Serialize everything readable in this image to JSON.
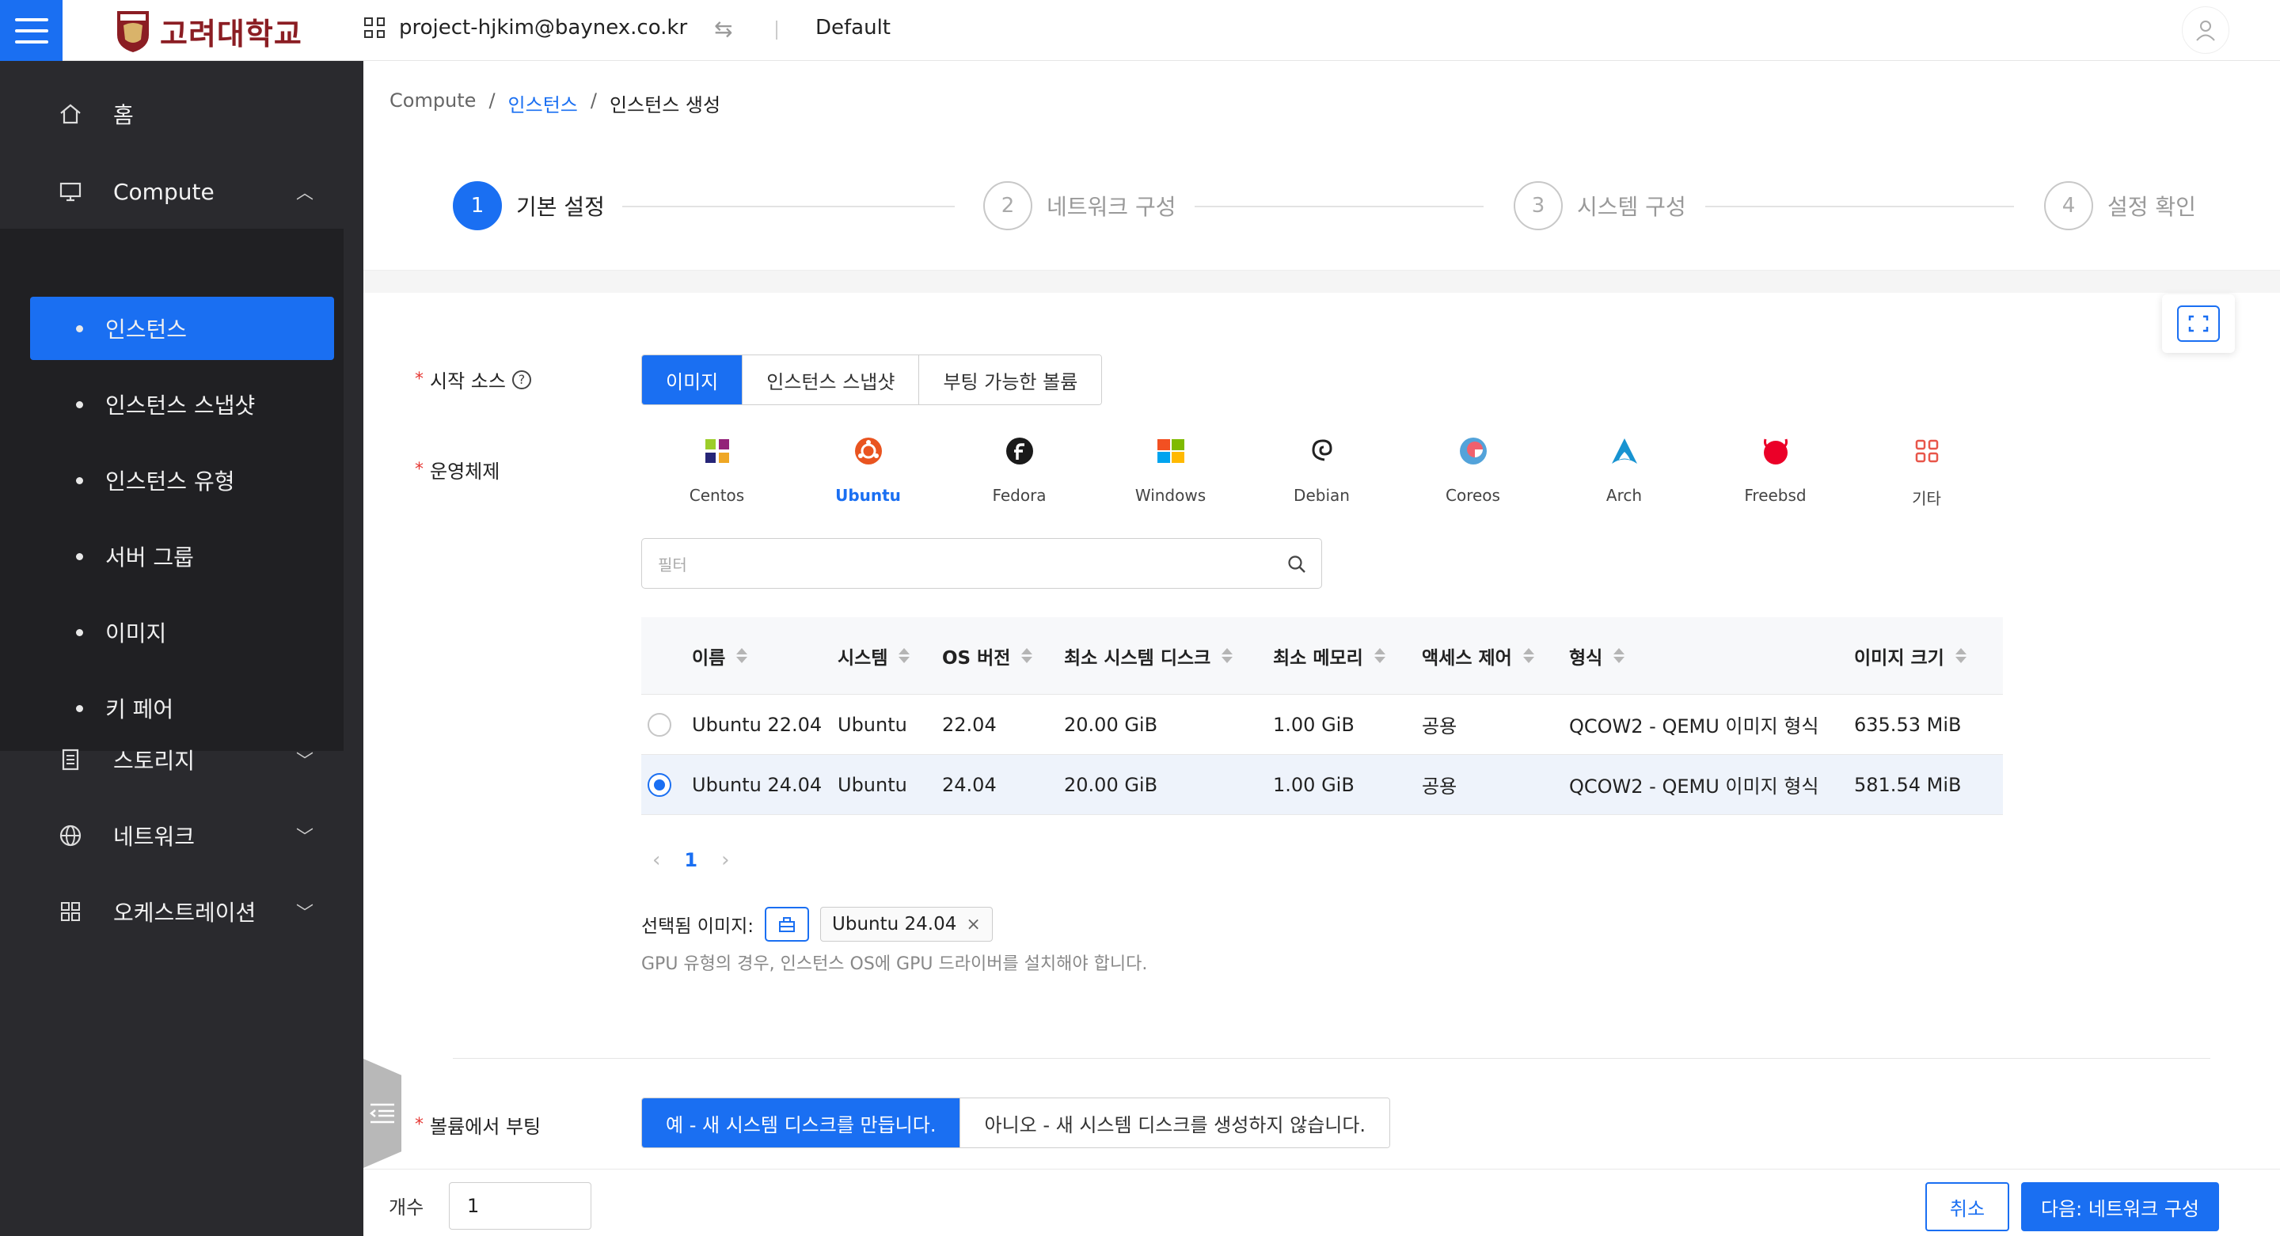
{
  "header": {
    "logo_text": "고려대학교",
    "project": "project-hjkim@baynex.co.kr",
    "domain": "Default"
  },
  "sidebar": {
    "home": "홈",
    "compute": "Compute",
    "compute_items": [
      "인스턴스",
      "인스턴스 스냅샷",
      "인스턴스 유형",
      "서버 그룹",
      "이미지",
      "키 페어"
    ],
    "storage": "스토리지",
    "network": "네트워크",
    "orchestration": "오케스트레이션"
  },
  "breadcrumb": {
    "root": "Compute",
    "link": "인스턴스",
    "current": "인스턴스 생성",
    "sep": "/"
  },
  "steps": [
    {
      "num": "1",
      "label": "기본 설정"
    },
    {
      "num": "2",
      "label": "네트워크 구성"
    },
    {
      "num": "3",
      "label": "시스템 구성"
    },
    {
      "num": "4",
      "label": "설정 확인"
    }
  ],
  "form": {
    "start_source_label": "시작 소스",
    "start_source_options": [
      "이미지",
      "인스턴스 스냅샷",
      "부팅 가능한 볼륨"
    ],
    "os_label": "운영체제",
    "os_options": [
      "Centos",
      "Ubuntu",
      "Fedora",
      "Windows",
      "Debian",
      "Coreos",
      "Arch",
      "Freebsd",
      "기타"
    ],
    "filter_placeholder": "필터",
    "boot_volume_label": "볼륨에서 부팅",
    "boot_volume_options": [
      "예 - 새 시스템 디스크를 만듭니다.",
      "아니오 - 새 시스템 디스크를 생성하지 않습니다."
    ],
    "selected_image_label": "선택됨 이미지:",
    "selected_image": "Ubuntu 24.04",
    "hint": "GPU 유형의 경우, 인스턴스 OS에 GPU 드라이버를 설치해야 합니다."
  },
  "table": {
    "columns": [
      "이름",
      "시스템",
      "OS 버전",
      "최소 시스템 디스크",
      "최소 메모리",
      "액세스 제어",
      "형식",
      "이미지 크기"
    ],
    "rows": [
      {
        "name": "Ubuntu 22.04",
        "system": "Ubuntu",
        "os_version": "22.04",
        "min_disk": "20.00 GiB",
        "min_memory": "1.00 GiB",
        "access": "공용",
        "format": "QCOW2 - QEMU 이미지 형식",
        "size": "635.53 MiB",
        "selected": false
      },
      {
        "name": "Ubuntu 24.04",
        "system": "Ubuntu",
        "os_version": "24.04",
        "min_disk": "20.00 GiB",
        "min_memory": "1.00 GiB",
        "access": "공용",
        "format": "QCOW2 - QEMU 이미지 형식",
        "size": "581.54 MiB",
        "selected": true
      }
    ],
    "page": "1"
  },
  "footer": {
    "count_label": "개수",
    "count_value": "1",
    "cancel": "취소",
    "next": "다음: 네트워크 구성"
  },
  "colors": {
    "accent": "#1a6ff2",
    "sidebar": "#2a2a2e",
    "brand": "#8b1d23"
  }
}
